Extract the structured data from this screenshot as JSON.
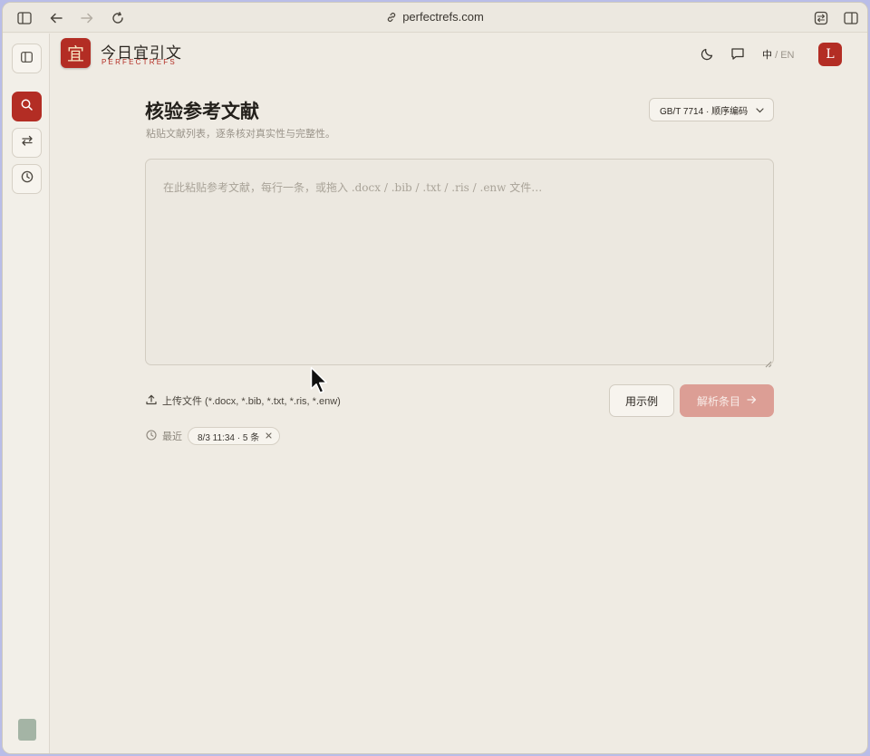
{
  "browser": {
    "url": "perfectrefs.com"
  },
  "brand": {
    "name_cn": "今日宜引文",
    "name_en": "PERFECTREFS",
    "logo_glyph": "宜"
  },
  "topbar": {
    "lang_active": "中",
    "lang_sep": "/",
    "lang_other": "EN",
    "avatar_initial": "L"
  },
  "main": {
    "title": "核验参考文献",
    "subtitle": "粘贴文献列表，逐条核对真实性与完整性。",
    "citation_style": "GB/T 7714 · 顺序编码",
    "textarea_placeholder": "在此粘贴参考文献，每行一条，或拖入 .docx / .bib / .txt / .ris / .enw 文件…",
    "upload_label": "上传文件 (*.docx, *.bib, *.txt, *.ris, *.enw)",
    "example_button": "用示例",
    "parse_button": "解析条目",
    "recent_label": "最近",
    "recent_chip": "8/3 11:34 · 5 条"
  },
  "colors": {
    "accent": "#b32d24",
    "background": "#efebe3",
    "parse_button_disabled": "#dc9e95"
  },
  "icons": {
    "sidebar_toggle": "sidebar-icon",
    "search": "search-icon",
    "convert": "swap-icon",
    "history": "clock-icon",
    "theme": "moon-icon",
    "feedback": "chat-icon"
  }
}
